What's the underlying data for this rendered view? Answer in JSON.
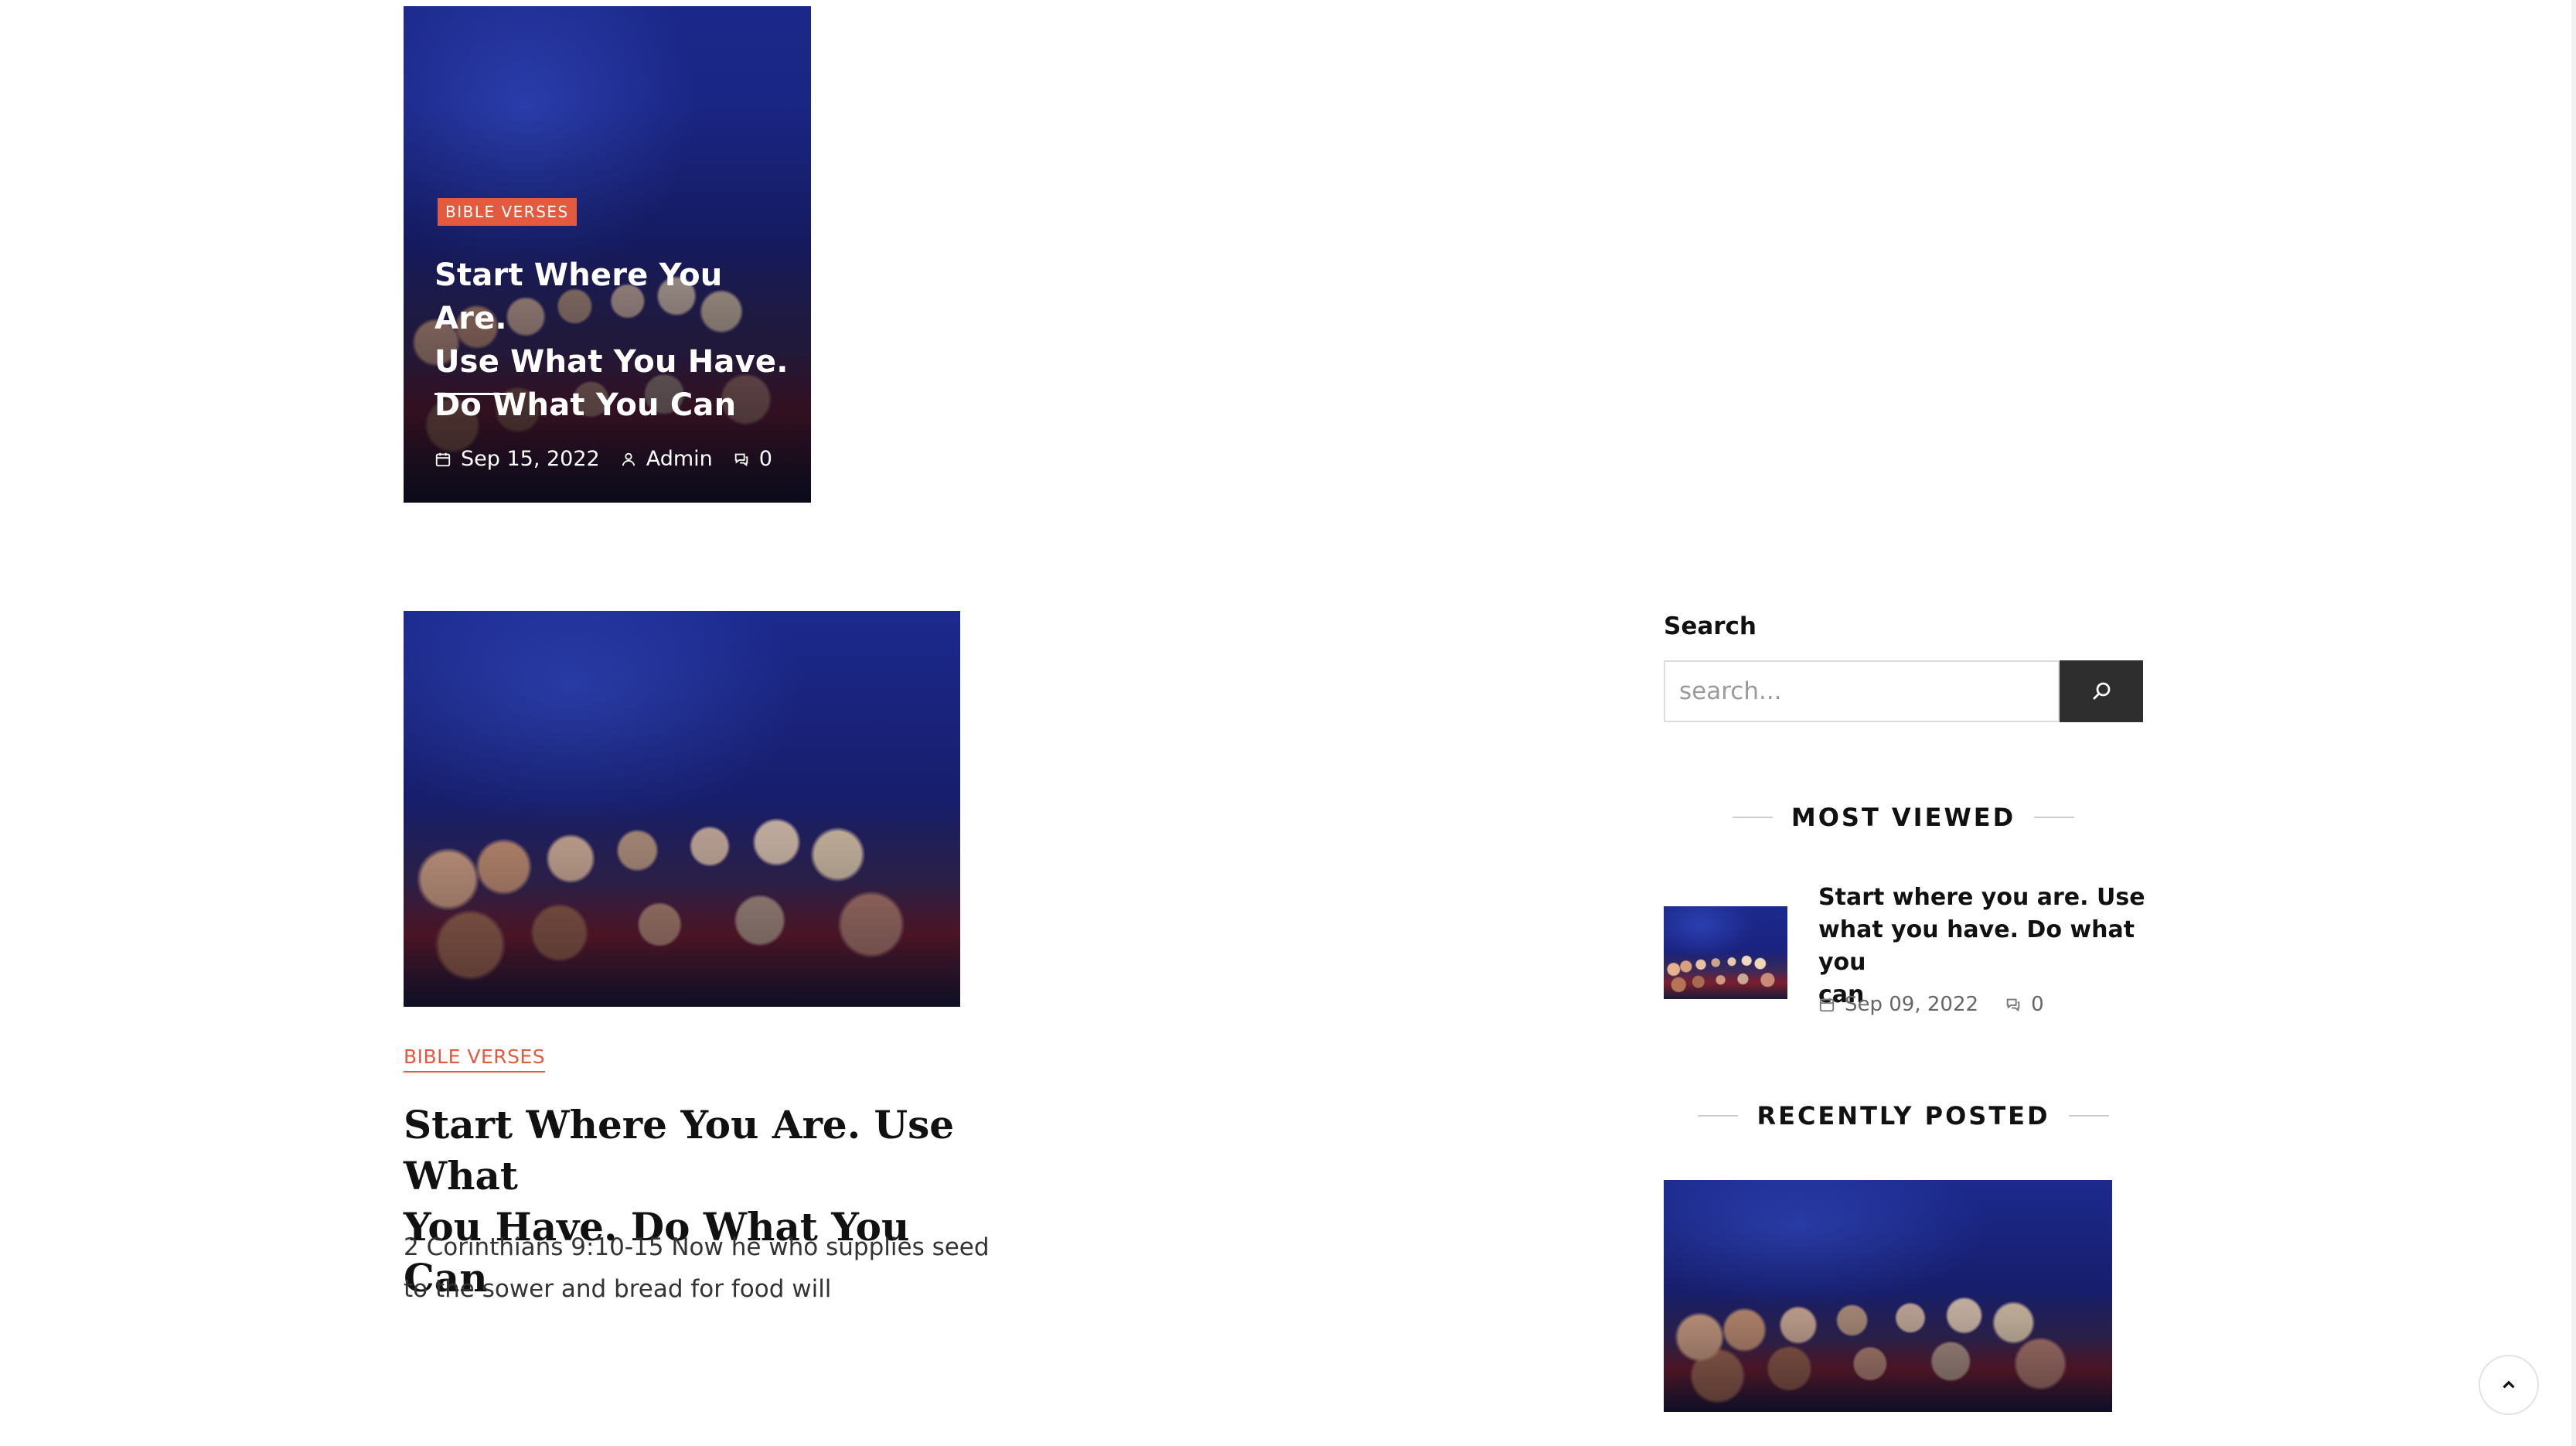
{
  "featured": {
    "category": "BIBLE VERSES",
    "title_lines": [
      "Start Where You Are.",
      "Use What You Have.",
      "Do What You Can"
    ],
    "date": "Sep 15, 2022",
    "author": "Admin",
    "comments": "0"
  },
  "post": {
    "category": "BIBLE VERSES",
    "title_lines": [
      "Start Where You Are. Use What",
      "You Have. Do What You Can"
    ],
    "excerpt_lines": [
      "2 Corinthians 9:10-15 Now he who supplies seed",
      "to the sower and bread for food will"
    ]
  },
  "sidebar": {
    "search": {
      "title": "Search",
      "placeholder": "search..."
    },
    "most_viewed": {
      "heading": "MOST VIEWED",
      "item": {
        "title_lines": [
          "Start where you are. Use",
          "what you have. Do what you",
          "can"
        ],
        "date": "Sep 09, 2022",
        "comments": "0"
      }
    },
    "recently_posted": {
      "heading": "RECENTLY POSTED"
    }
  },
  "icons": {
    "calendar": "calendar-icon",
    "user": "user-icon",
    "comments": "comments-icon",
    "search": "search-icon",
    "scroll_top": "chevron-up-icon"
  },
  "colors": {
    "accent": "#e35a3f",
    "search_button": "#2e2e2e"
  }
}
